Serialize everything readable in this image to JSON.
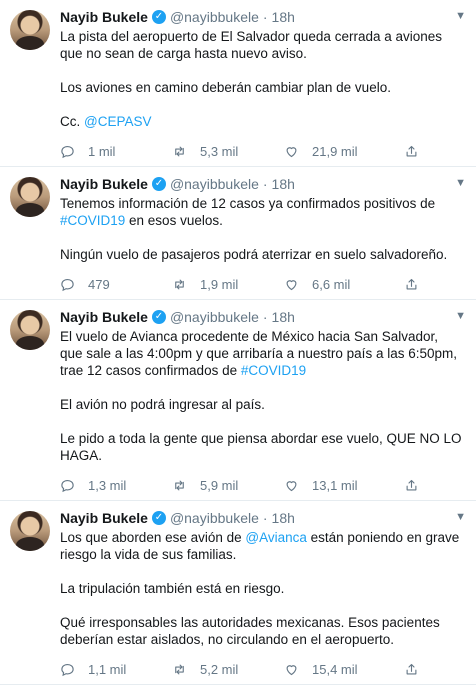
{
  "tweets": [
    {
      "name": "Nayib Bukele",
      "handle": "@nayibbukele",
      "time": "18h",
      "paragraphs": [
        [
          {
            "t": "La pista del aeropuerto de El Salvador queda cerrada a aviones que no sean de carga hasta nuevo aviso."
          }
        ],
        [
          {
            "t": "Los aviones en camino deberán cambiar plan de vuelo."
          }
        ],
        [
          {
            "t": "Cc. "
          },
          {
            "t": "@CEPASV",
            "link": true
          }
        ]
      ],
      "replies": "1 mil",
      "retweets": "5,3 mil",
      "likes": "21,9 mil"
    },
    {
      "name": "Nayib Bukele",
      "handle": "@nayibbukele",
      "time": "18h",
      "paragraphs": [
        [
          {
            "t": "Tenemos información de 12 casos ya confirmados positivos de "
          },
          {
            "t": "#COVID19",
            "link": true
          },
          {
            "t": " en esos vuelos."
          }
        ],
        [
          {
            "t": "Ningún vuelo de pasajeros podrá aterrizar en suelo salvadoreño."
          }
        ]
      ],
      "replies": "479",
      "retweets": "1,9 mil",
      "likes": "6,6 mil"
    },
    {
      "name": "Nayib Bukele",
      "handle": "@nayibbukele",
      "time": "18h",
      "paragraphs": [
        [
          {
            "t": "El vuelo de Avianca procedente de México hacia San Salvador, que sale a las 4:00pm y que arribaría a nuestro país a las 6:50pm, trae 12 casos confirmados de "
          },
          {
            "t": "#COVID19",
            "link": true
          }
        ],
        [
          {
            "t": "El avión no podrá ingresar al país."
          }
        ],
        [
          {
            "t": "Le pido a toda la gente que piensa abordar ese vuelo, QUE NO LO HAGA."
          }
        ]
      ],
      "replies": "1,3 mil",
      "retweets": "5,9 mil",
      "likes": "13,1 mil"
    },
    {
      "name": "Nayib Bukele",
      "handle": "@nayibbukele",
      "time": "18h",
      "paragraphs": [
        [
          {
            "t": "Los que aborden ese avión de "
          },
          {
            "t": "@Avianca",
            "link": true
          },
          {
            "t": " están poniendo en grave riesgo la vida de sus familias."
          }
        ],
        [
          {
            "t": "La tripulación también está en riesgo."
          }
        ],
        [
          {
            "t": "Qué irresponsables las autoridades mexicanas. Esos pacientes deberían estar aislados, no circulando en el aeropuerto."
          }
        ]
      ],
      "replies": "1,1 mil",
      "retweets": "5,2 mil",
      "likes": "15,4 mil"
    }
  ],
  "icons": {
    "verified": "verified-badge-icon",
    "reply": "reply-icon",
    "retweet": "retweet-icon",
    "like": "like-icon",
    "share": "share-icon",
    "caret": "chevron-down-icon"
  },
  "colors": {
    "link": "#1da1f2",
    "muted": "#657786",
    "text": "#14171a",
    "divider": "#e6ecf0"
  }
}
